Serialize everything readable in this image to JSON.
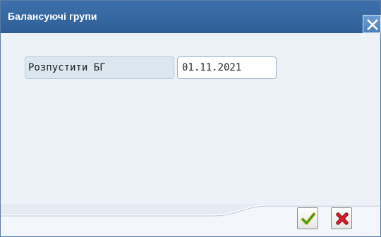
{
  "dialog": {
    "title": "Балансуючі групи",
    "close_icon": "close-icon"
  },
  "form": {
    "field_label": "Розпустити БГ",
    "field_value": "01.11.2021"
  },
  "footer": {
    "confirm_icon": "checkmark-icon",
    "cancel_icon": "cross-icon"
  },
  "colors": {
    "titlebar": "#3467a0",
    "content_bg": "#edf2f8",
    "confirm_green": "#2e9b1c",
    "cancel_red": "#c8161d"
  }
}
